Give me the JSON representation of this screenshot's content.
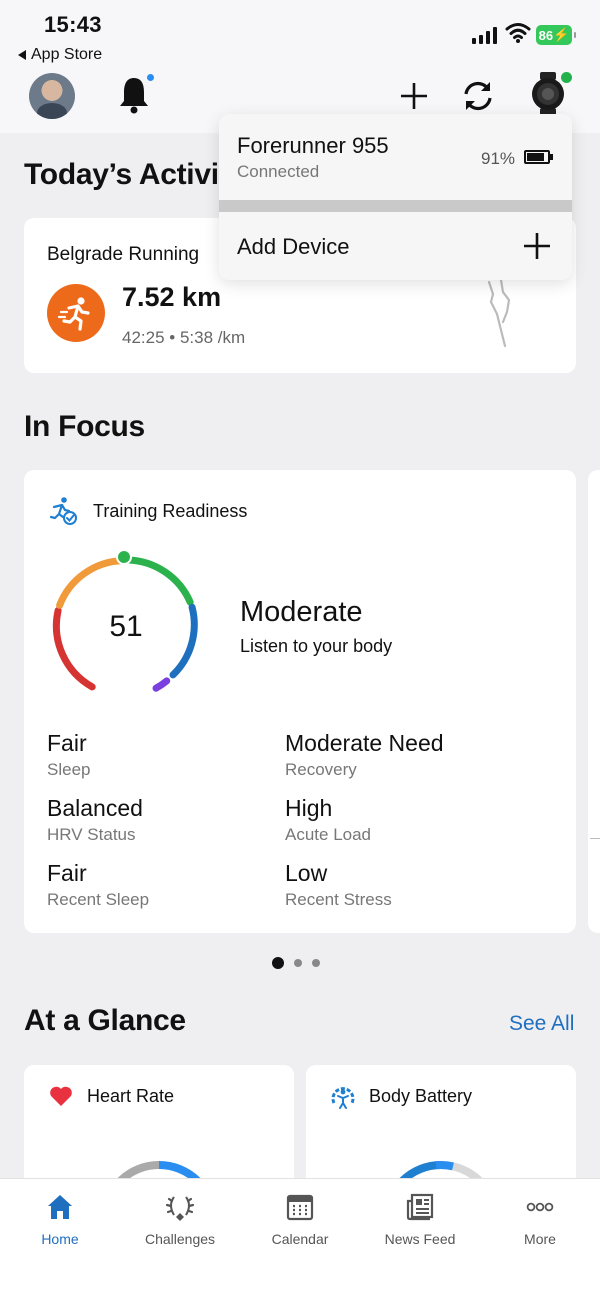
{
  "status_bar": {
    "time": "15:43",
    "back_label": "App Store",
    "battery": "86"
  },
  "header": {
    "avatar_icon": "user-avatar",
    "notification_icon": "bell-icon",
    "add_icon": "plus-icon",
    "sync_icon": "sync-icon",
    "device_icon": "watch-icon",
    "accent_color": "#1f6fbf"
  },
  "device_menu": {
    "device_name": "Forerunner 955",
    "device_status": "Connected",
    "battery_percent": "91%",
    "add_device_label": "Add Device"
  },
  "today": {
    "heading": "Today’s Activi",
    "activity": {
      "name": "Belgrade Running",
      "distance": "7.52 km",
      "meta": "42:25 • 5:38 /km",
      "icon": "running-icon",
      "color": "#ee6a1b"
    }
  },
  "focus": {
    "heading": "In Focus",
    "card": {
      "title": "Training Readiness",
      "score": "51",
      "level": "Moderate",
      "subtitle": "Listen to your body",
      "metrics": [
        {
          "value": "Fair",
          "label": "Sleep"
        },
        {
          "value": "Moderate Need",
          "label": "Recovery"
        },
        {
          "value": "Balanced",
          "label": "HRV Status"
        },
        {
          "value": "High",
          "label": "Acute Load"
        },
        {
          "value": "Fair",
          "label": "Recent Sleep"
        },
        {
          "value": "Low",
          "label": "Recent Stress"
        }
      ]
    },
    "page_index": 1,
    "page_count": 3
  },
  "glance": {
    "heading": "At a Glance",
    "see_all": "See All",
    "cards": [
      {
        "title": "Heart Rate",
        "icon": "heart-icon"
      },
      {
        "title": "Body Battery",
        "icon": "body-battery-icon"
      }
    ]
  },
  "tabs": [
    {
      "label": "Home",
      "icon": "home-icon",
      "active": true
    },
    {
      "label": "Challenges",
      "icon": "laurel-icon",
      "active": false
    },
    {
      "label": "Calendar",
      "icon": "calendar-icon",
      "active": false
    },
    {
      "label": "News Feed",
      "icon": "news-icon",
      "active": false
    },
    {
      "label": "More",
      "icon": "more-icon",
      "active": false
    }
  ]
}
